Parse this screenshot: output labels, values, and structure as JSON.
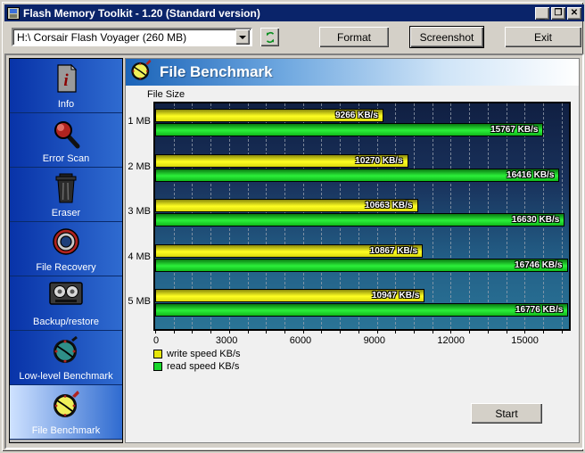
{
  "window": {
    "title": "Flash Memory Toolkit - 1.20 (Standard version)",
    "app_icon": "flash-drive-icon",
    "minimize_glyph": "_",
    "maximize_glyph": "❐",
    "close_glyph": "✕"
  },
  "toolbar": {
    "device_select_value": "H:\\ Corsair Flash Voyager   (260 MB)",
    "refresh_icon": "refresh-icon",
    "format_label": "Format",
    "screenshot_label": "Screenshot",
    "exit_label": "Exit"
  },
  "sidebar": {
    "items": [
      {
        "label": "Info",
        "icon": "info-document-icon",
        "selected": false
      },
      {
        "label": "Error Scan",
        "icon": "magnifier-icon",
        "selected": false
      },
      {
        "label": "Eraser",
        "icon": "trash-can-icon",
        "selected": false
      },
      {
        "label": "File Recovery",
        "icon": "lifebuoy-icon",
        "selected": false
      },
      {
        "label": "Backup/restore",
        "icon": "tape-cassette-icon",
        "selected": false
      },
      {
        "label": "Low-level Benchmark",
        "icon": "stopwatch-teal-icon",
        "selected": false
      },
      {
        "label": "File Benchmark",
        "icon": "stopwatch-yellow-icon",
        "selected": true
      }
    ]
  },
  "panel": {
    "title": "File Benchmark",
    "title_icon": "stopwatch-yellow-icon",
    "start_label": "Start"
  },
  "chart_data": {
    "type": "bar",
    "orientation": "horizontal",
    "title": "File Benchmark",
    "xlabel": "",
    "ylabel": "File Size",
    "categories": [
      "1 MB",
      "2 MB",
      "3 MB",
      "4 MB",
      "5 MB"
    ],
    "series": [
      {
        "name": "write speed KB/s",
        "color": "#e6e60a",
        "values": [
          9266,
          10270,
          10663,
          10867,
          10947
        ],
        "labels": [
          "9266 KB/s",
          "10270 KB/s",
          "10663 KB/s",
          "10867 KB/s",
          "10947 KB/s"
        ]
      },
      {
        "name": "read speed KB/s",
        "color": "#17d62b",
        "values": [
          15767,
          16416,
          16630,
          16746,
          16776
        ],
        "labels": [
          "15767 KB/s",
          "16416 KB/s",
          "16630 KB/s",
          "16746 KB/s",
          "16776 KB/s"
        ]
      }
    ],
    "xticks": [
      0,
      3000,
      6000,
      9000,
      12000,
      15000
    ],
    "xtick_labels": [
      "0",
      "3000",
      "6000",
      "9000",
      "12000",
      "15000"
    ],
    "xlim": [
      0,
      16800
    ],
    "grid": true,
    "grid_style": "dashed-vertical",
    "legend_position": "below-left",
    "legend": [
      "write speed KB/s",
      "read speed KB/s"
    ],
    "plot_bg_top": "#101f42",
    "plot_bg_bottom": "#2a7496"
  }
}
